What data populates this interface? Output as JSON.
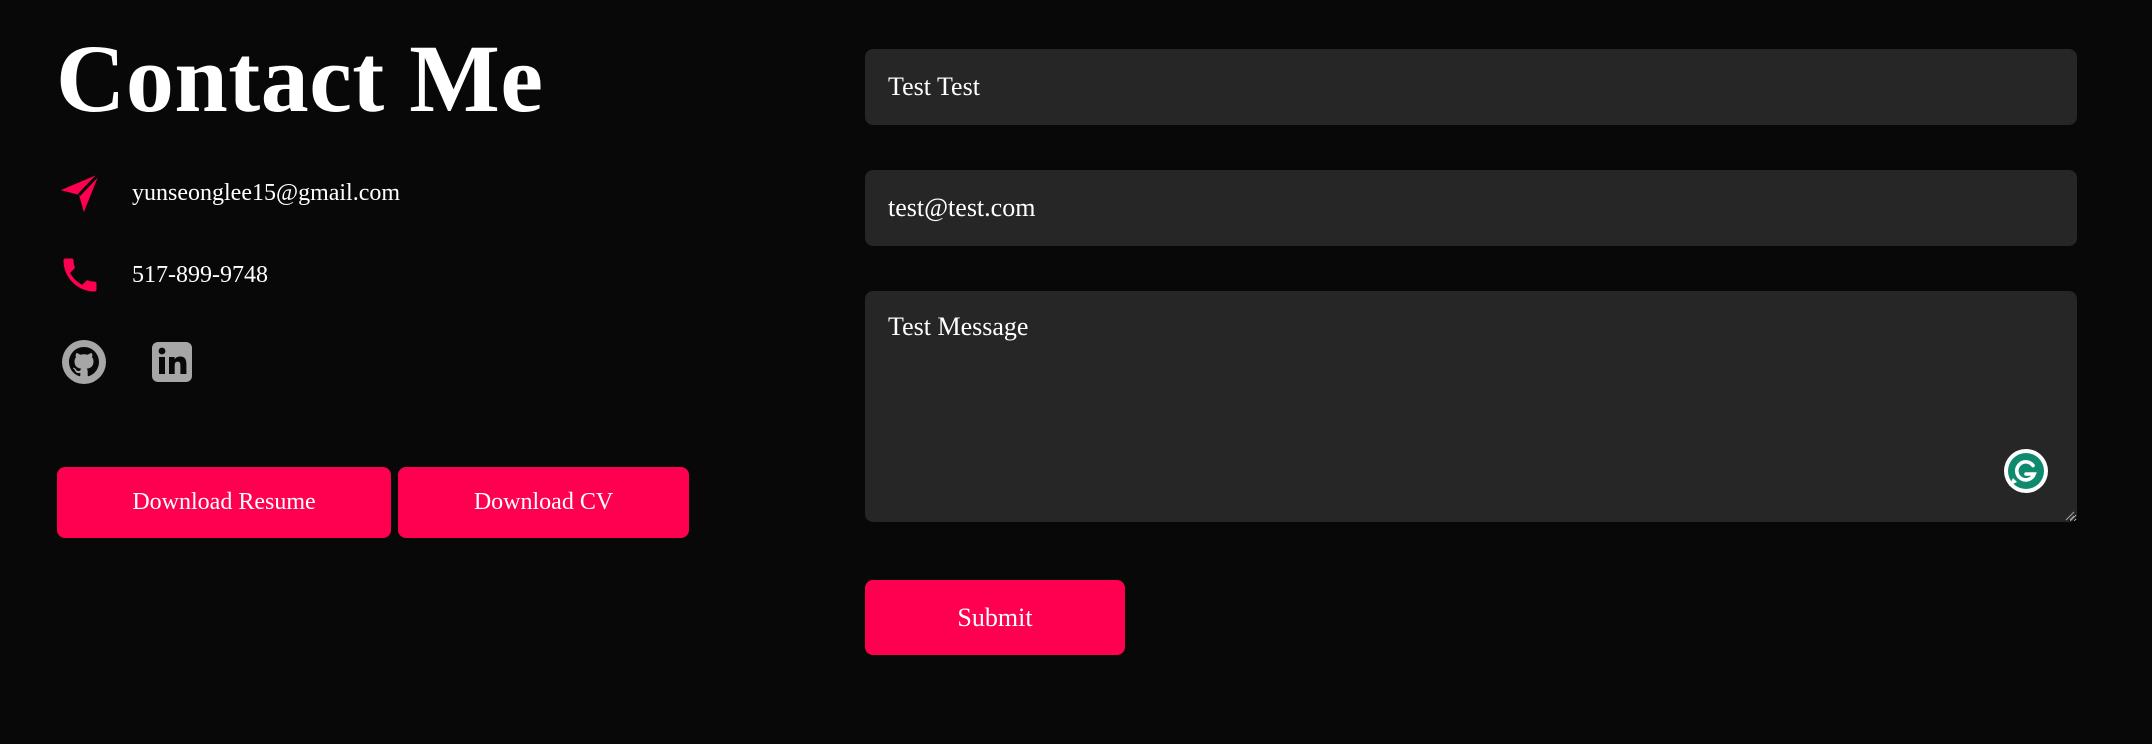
{
  "header": {
    "title": "Contact Me"
  },
  "contact": {
    "email": "yunseonglee15@gmail.com",
    "phone": "517-899-9748",
    "email_icon": "paper-plane-icon",
    "phone_icon": "phone-icon"
  },
  "socials": [
    {
      "icon": "github-icon"
    },
    {
      "icon": "linkedin-icon"
    }
  ],
  "downloads": {
    "resume_label": "Download Resume",
    "cv_label": "Download CV"
  },
  "form": {
    "name_value": "Test Test",
    "email_value": "test@test.com",
    "message_value": "Test Message",
    "submit_label": "Submit"
  },
  "colors": {
    "background": "#080808",
    "accent": "#ff0050",
    "field_bg": "#262626",
    "social_icon": "#a6a6a6",
    "grammarly": "#15c39a"
  }
}
